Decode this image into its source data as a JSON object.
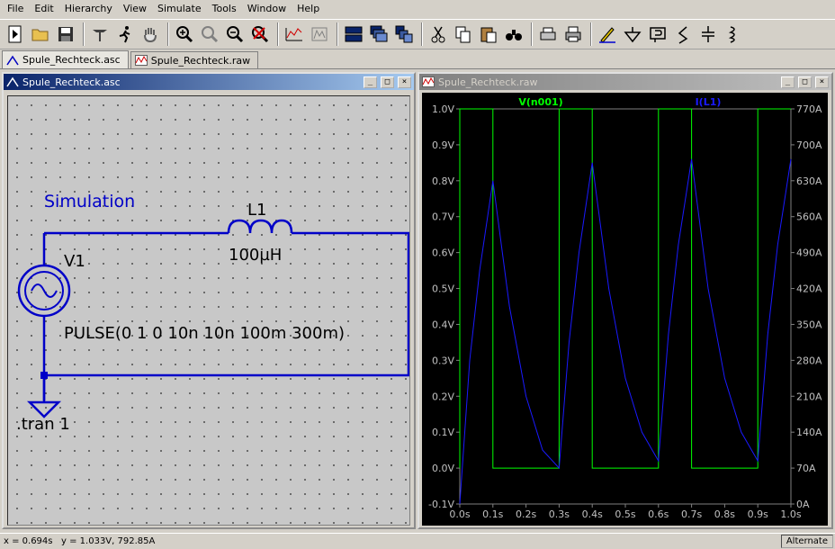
{
  "menu": [
    "File",
    "Edit",
    "Hierarchy",
    "View",
    "Simulate",
    "Tools",
    "Window",
    "Help"
  ],
  "tabs": [
    {
      "label": "Spule_Rechteck.asc",
      "active": true
    },
    {
      "label": "Spule_Rechteck.raw",
      "active": false
    }
  ],
  "schematic": {
    "title": "Spule_Rechteck.asc",
    "sim_label": "Simulation",
    "inductor_name": "L1",
    "inductor_value": "100µH",
    "source_name": "V1",
    "source_value": "PULSE(0 1 0 10n 10n 100m 300m)",
    "directive": ".tran 1"
  },
  "waveform": {
    "title": "Spule_Rechteck.raw",
    "trace_v_label": "V(n001)",
    "trace_i_label": "I(L1)",
    "trace_v_color": "#00ff00",
    "trace_i_color": "#1a1aff"
  },
  "chart_data": {
    "type": "line",
    "x_ticks": [
      "0.0s",
      "0.1s",
      "0.2s",
      "0.3s",
      "0.4s",
      "0.5s",
      "0.6s",
      "0.7s",
      "0.8s",
      "0.9s",
      "1.0s"
    ],
    "y_left_ticks": [
      "1.0V",
      "0.9V",
      "0.8V",
      "0.7V",
      "0.6V",
      "0.5V",
      "0.4V",
      "0.3V",
      "0.2V",
      "0.1V",
      "0.0V",
      "-0.1V"
    ],
    "y_right_ticks": [
      "770A",
      "700A",
      "630A",
      "560A",
      "490A",
      "420A",
      "350A",
      "280A",
      "210A",
      "140A",
      "70A",
      "0A"
    ],
    "xlim": [
      0,
      1.0
    ],
    "ylim_left": [
      -0.1,
      1.0
    ],
    "ylim_right": [
      0,
      770
    ],
    "grid": false,
    "series": [
      {
        "name": "V(n001)",
        "axis": "left",
        "x": [
          0,
          0,
          0.1,
          0.1,
          0.3,
          0.3,
          0.4,
          0.4,
          0.6,
          0.6,
          0.7,
          0.7,
          0.9,
          0.9,
          1.0
        ],
        "y": [
          0,
          1,
          1,
          0,
          0,
          1,
          1,
          0,
          0,
          1,
          1,
          0,
          0,
          1,
          1
        ]
      },
      {
        "name": "I(L1)",
        "axis": "right",
        "x": [
          0,
          0.03,
          0.06,
          0.1,
          0.15,
          0.2,
          0.25,
          0.3,
          0.33,
          0.36,
          0.4,
          0.45,
          0.5,
          0.55,
          0.6,
          0.63,
          0.66,
          0.7,
          0.75,
          0.8,
          0.85,
          0.9,
          0.93,
          0.96,
          1.0
        ],
        "y": [
          0,
          280,
          455,
          630,
          385,
          210,
          105,
          70,
          315,
          490,
          665,
          420,
          245,
          140,
          84,
          330,
          505,
          672,
          420,
          245,
          140,
          84,
          330,
          505,
          672
        ]
      }
    ]
  },
  "status": {
    "text": "x = 0.694s   y = 1.033V, 792.85A",
    "mode": "Alternate"
  }
}
